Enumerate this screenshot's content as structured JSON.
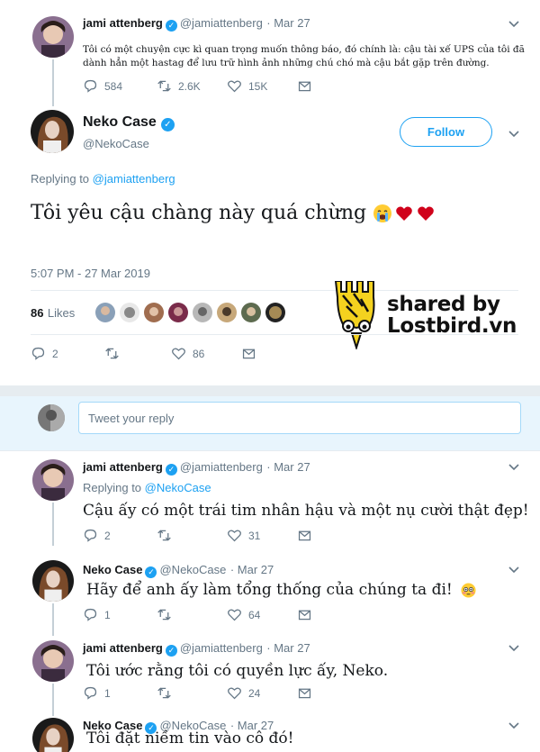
{
  "tweet1": {
    "name": "jami attenberg",
    "handle": "@jamiattenberg",
    "date": "· Mar 27",
    "text": "Tôi có một chuyện cực kì quan trọng muốn thông báo, đó chính là: cậu tài xế UPS của tôi đã dành hẳn một hastag để lưu trữ hình ảnh những chú chó mà cậu bắt gặp trên đường.",
    "replies": "584",
    "retweets": "2.6K",
    "likes": "15K"
  },
  "main": {
    "name": "Neko Case",
    "handle": "@NekoCase",
    "follow_label": "Follow",
    "replying_prefix": "Replying to",
    "replying_to": "@jamiattenberg",
    "text": "Tôi yêu cậu chàng này quá chừng",
    "emoji": [
      "crying-face",
      "heart",
      "heart"
    ],
    "timestamp": "5:07 PM - 27 Mar 2019",
    "likes_count": "86",
    "likes_label": "Likes",
    "replies": "2",
    "retweets": "",
    "likes": "86"
  },
  "watermark": {
    "line1": "shared by",
    "line2": "Lostbird.vn"
  },
  "compose": {
    "placeholder": "Tweet your reply"
  },
  "replies": [
    {
      "name": "jami attenberg",
      "handle": "@jamiattenberg",
      "date": "· Mar 27",
      "replying_prefix": "Replying to",
      "replying_to": "@NekoCase",
      "text": "Cậu ấy có một trái tim nhân hậu và một nụ cười thật đẹp!",
      "replies": "2",
      "retweets": "",
      "likes": "31"
    },
    {
      "name": "Neko Case",
      "handle": "@NekoCase",
      "date": "· Mar 27",
      "text": "Hãy để anh ấy làm tổng thống của chúng ta đi!",
      "replies": "1",
      "retweets": "",
      "likes": "64"
    },
    {
      "name": "jami attenberg",
      "handle": "@jamiattenberg",
      "date": "· Mar 27",
      "text": "Tôi ước rằng tôi có quyền lực ấy, Neko.",
      "replies": "1",
      "retweets": "",
      "likes": "24"
    },
    {
      "name": "Neko Case",
      "handle": "@NekoCase",
      "date": "· Mar 27",
      "text": "Tôi đặt niềm tin vào cô đó!"
    }
  ],
  "colors": {
    "accent": "#1da1f2",
    "heart": "#d0021b",
    "muted": "#657786"
  }
}
